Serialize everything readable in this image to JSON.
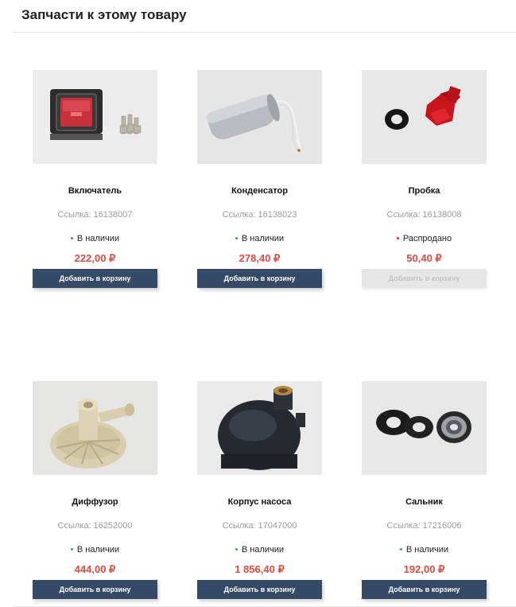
{
  "section": {
    "title": "Запчасти к этому товару"
  },
  "colors": {
    "button": "#344a66",
    "price": "#e3483d",
    "in_stock_dot": "#2fae3b",
    "sold_out_dot": "#d32f2f"
  },
  "products": [
    {
      "name": "Включатель",
      "sku": "Ссылка: 16138007",
      "stock": "В наличии",
      "price": "222,00 ₽",
      "button": "Добавить в корзину",
      "icon": "rocker-switch-image"
    },
    {
      "name": "Конденсатор",
      "sku": "Ссылка: 16138023",
      "stock": "В наличии",
      "price": "278,40 ₽",
      "button": "Добавить в корзину",
      "icon": "capacitor-image"
    },
    {
      "name": "Пробка",
      "sku": "Ссылка: 16138008",
      "stock": "Распродано",
      "price": "50,40 ₽",
      "button": "Добавить в корзину",
      "icon": "plug-cap-image"
    },
    {
      "name": "Диффузор",
      "sku": "Ссылка: 16252000",
      "stock": "В наличии",
      "price": "444,00 ₽",
      "button": "Добавить в корзину",
      "icon": "diffuser-image"
    },
    {
      "name": "Корпус насоса",
      "sku": "Ссылка: 17047000",
      "stock": "В наличии",
      "price": "1 856,40 ₽",
      "button": "Добавить в корзину",
      "icon": "pump-housing-image"
    },
    {
      "name": "Сальник",
      "sku": "Ссылка: 17216006",
      "stock": "В наличии",
      "price": "192,00 ₽",
      "button": "Добавить в корзину",
      "icon": "shaft-seal-image"
    }
  ]
}
